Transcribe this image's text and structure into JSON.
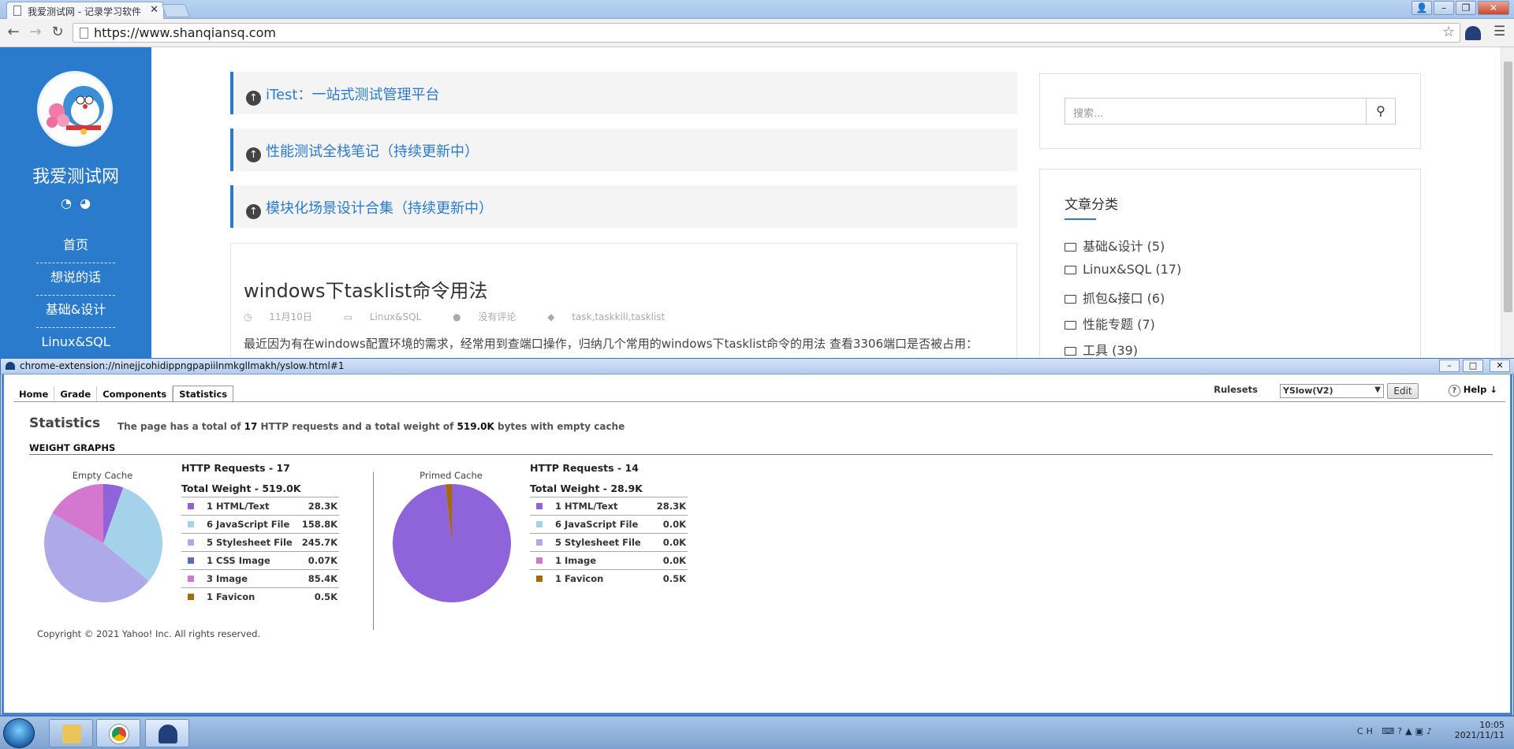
{
  "browser": {
    "tab_title": "我爱测试网 - 记录学习软件",
    "url": "https://www.shanqiansq.com"
  },
  "site": {
    "name": "我爱测试网",
    "nav": [
      "首页",
      "想说的话",
      "基础&设计",
      "Linux&SQL"
    ],
    "top_links": [
      "iTest：一站式测试管理平台",
      "性能测试全栈笔记（持续更新中）",
      "模块化场景设计合集（持续更新中）"
    ],
    "article": {
      "title": "windows下tasklist命令用法",
      "date": "11月10日",
      "category": "Linux&SQL",
      "comments": "没有评论",
      "tags": "task,taskkill,tasklist",
      "excerpt": "最近因为有在windows配置环境的需求，经常用到查端口操作，归纳几个常用的windows下tasklist命令的用法 查看3306端口是否被占用："
    },
    "search_placeholder": "搜索...",
    "categories_title": "文章分类",
    "categories": [
      "基础&设计 (5)",
      "Linux&SQL (17)",
      "抓包&接口 (6)",
      "性能专题 (7)",
      "工具 (39)"
    ]
  },
  "yslow": {
    "window_title": "chrome-extension://ninejjcohidippngpapiilnmkgllmakh/yslow.html#1",
    "tabs": [
      "Home",
      "Grade",
      "Components",
      "Statistics"
    ],
    "rulesets_label": "Rulesets",
    "ruleset_value": "YSlow(V2)",
    "edit_label": "Edit",
    "help_label": "Help",
    "stats_heading": "Statistics",
    "summary_pre": "The page has a total of",
    "summary_requests": "17",
    "summary_mid": "HTTP requests and a total weight of",
    "summary_weight": "519.0K",
    "summary_post": "bytes with empty cache",
    "graphs_title": "WEIGHT GRAPHS",
    "empty": {
      "label": "Empty Cache",
      "requests": "HTTP Requests - 17",
      "weight": "Total Weight - 519.0K",
      "rows": [
        {
          "label": "1 HTML/Text",
          "value": "28.3K",
          "color": "#8f63d9"
        },
        {
          "label": "6 JavaScript File",
          "value": "158.8K",
          "color": "#a3d2ea"
        },
        {
          "label": "5 Stylesheet File",
          "value": "245.7K",
          "color": "#aea9e8"
        },
        {
          "label": "1 CSS Image",
          "value": "0.07K",
          "color": "#5a6fae"
        },
        {
          "label": "3 Image",
          "value": "85.4K",
          "color": "#d478cf"
        },
        {
          "label": "1 Favicon",
          "value": "0.5K",
          "color": "#a66a08"
        }
      ],
      "weights": [
        28.3,
        158.8,
        245.7,
        0.07,
        85.4,
        0.5
      ]
    },
    "primed": {
      "label": "Primed Cache",
      "requests": "HTTP Requests - 14",
      "weight": "Total Weight - 28.9K",
      "rows": [
        {
          "label": "1 HTML/Text",
          "value": "28.3K",
          "color": "#8f63d9"
        },
        {
          "label": "6 JavaScript File",
          "value": "0.0K",
          "color": "#a3d2ea"
        },
        {
          "label": "5 Stylesheet File",
          "value": "0.0K",
          "color": "#aea9e8"
        },
        {
          "label": "1 Image",
          "value": "0.0K",
          "color": "#d478cf"
        },
        {
          "label": "1 Favicon",
          "value": "0.5K",
          "color": "#a66a08"
        }
      ],
      "weights": [
        28.3,
        0,
        0,
        0,
        0.5
      ]
    },
    "copyright": "Copyright © 2021 Yahoo! Inc. All rights reserved."
  },
  "taskbar": {
    "lang": "CH",
    "time": "10:05",
    "date": "2021/11/11"
  }
}
